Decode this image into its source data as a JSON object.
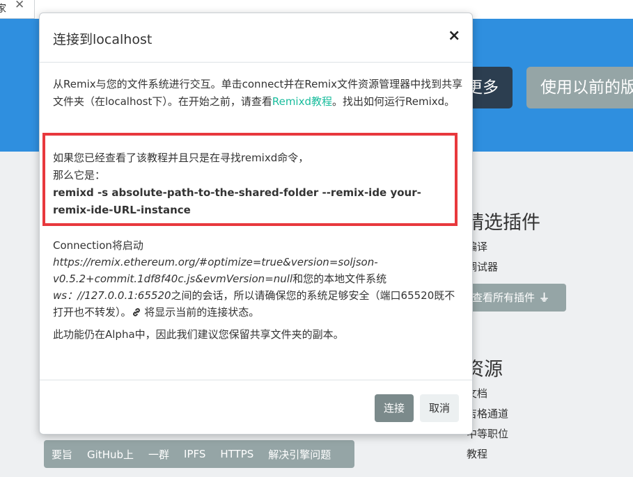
{
  "tab": {
    "label": "家",
    "close": "✕"
  },
  "hero": {
    "more_label": "更多",
    "prev_label": "使用以前的版"
  },
  "sidebar": {
    "featured_title": "精选插件",
    "featured_items": [
      "编译",
      "调试器"
    ],
    "all_plugins_label": "查看所有插件",
    "resources_title": "资源",
    "resource_items": [
      "文档",
      "吉格通道",
      "中等职位",
      "教程"
    ]
  },
  "footer": {
    "links": [
      "要旨",
      "GitHub上",
      "一群",
      "IPFS",
      "HTTPS",
      "解决引擎问题"
    ]
  },
  "modal": {
    "title": "连接到localhost",
    "close_icon": "×",
    "intro_before": "从Remix与您的文件系统进行交互。单击connect并在Remix文件资源管理器中找到共享文件夹（在localhost下）。在开始之前，请查看",
    "intro_link": "Remixd教程",
    "intro_after": "。找出如何运行Remixd。",
    "cmd_line1": "如果您已经查看了该教程并且只是在寻找remixd命令，",
    "cmd_line2": "那么它是：",
    "cmd": "remixd -s absolute-path-to-the-shared-folder --remix-ide your-remix-ide-URL-instance",
    "conn_prefix": "Connection将启动",
    "conn_url": "https://remix.ethereum.org/#optimize=true&version=soljson-v0.5.2+commit.1df8f40c.js&evmVersion=null",
    "conn_mid": "和您的本地文件系统",
    "conn_ws": "ws：//127.0.0.1:65520",
    "conn_suffix": "之间的会话，所以请确保您的系统足够安全（端口65520既不打开也不转发）。",
    "conn_end": " 将显示当前的连接状态。",
    "alpha_note": "此功能仍在Alpha中，因此我们建议您保留共享文件夹的副本。",
    "connect_label": "连接",
    "cancel_label": "取消"
  },
  "colors": {
    "hero": "#2f8fdf",
    "accent_link": "#18bc9c",
    "highlight_box": "#e8383d"
  }
}
